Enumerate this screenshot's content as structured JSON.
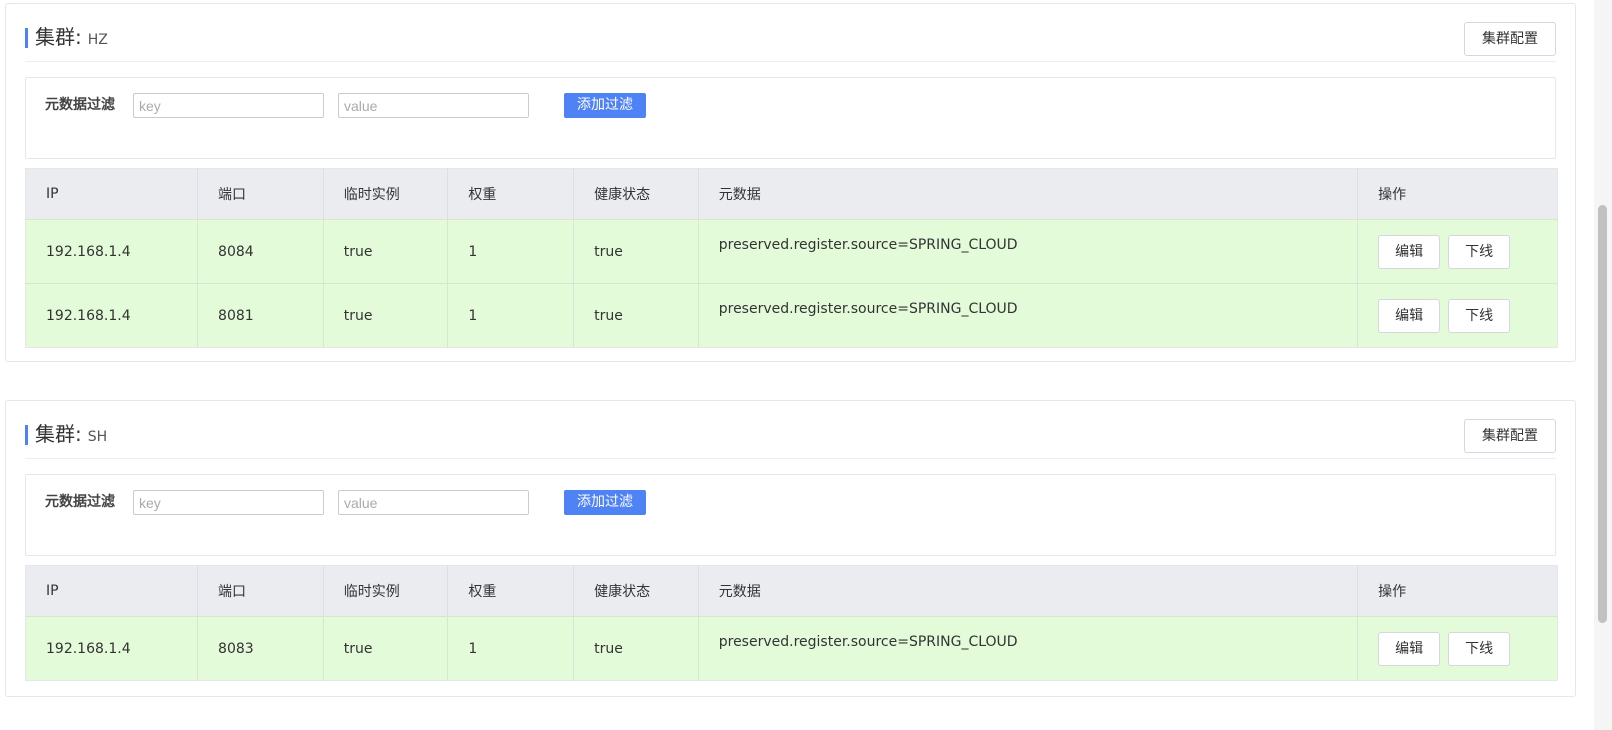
{
  "clusters": [
    {
      "title_prefix": "集群:",
      "name": "HZ",
      "config_button": "集群配置",
      "filter": {
        "label": "元数据过滤",
        "key_placeholder": "key",
        "value_placeholder": "value",
        "add_button": "添加过滤"
      },
      "columns": [
        "IP",
        "端口",
        "临时实例",
        "权重",
        "健康状态",
        "元数据",
        "操作"
      ],
      "rows": [
        {
          "ip": "192.168.1.4",
          "port": "8084",
          "ephemeral": "true",
          "weight": "1",
          "healthy": "true",
          "metadata": "preserved.register.source=SPRING_CLOUD",
          "edit": "编辑",
          "offline": "下线"
        },
        {
          "ip": "192.168.1.4",
          "port": "8081",
          "ephemeral": "true",
          "weight": "1",
          "healthy": "true",
          "metadata": "preserved.register.source=SPRING_CLOUD",
          "edit": "编辑",
          "offline": "下线"
        }
      ]
    },
    {
      "title_prefix": "集群:",
      "name": "SH",
      "config_button": "集群配置",
      "filter": {
        "label": "元数据过滤",
        "key_placeholder": "key",
        "value_placeholder": "value",
        "add_button": "添加过滤"
      },
      "columns": [
        "IP",
        "端口",
        "临时实例",
        "权重",
        "健康状态",
        "元数据",
        "操作"
      ],
      "rows": [
        {
          "ip": "192.168.1.4",
          "port": "8083",
          "ephemeral": "true",
          "weight": "1",
          "healthy": "true",
          "metadata": "preserved.register.source=SPRING_CLOUD",
          "edit": "编辑",
          "offline": "下线"
        }
      ]
    }
  ],
  "colors": {
    "accent": "#4e82f5",
    "header_bg": "#ebecf0",
    "healthy_row_bg": "#e3fbd9"
  }
}
